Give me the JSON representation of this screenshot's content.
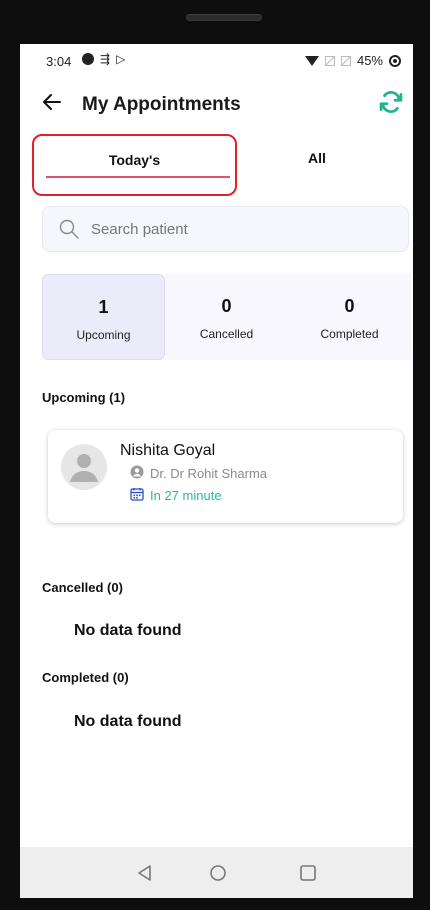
{
  "status_bar": {
    "time": "3:04",
    "battery": "45%"
  },
  "app_bar": {
    "title": "My Appointments",
    "back_icon": "arrow-left-icon",
    "refresh_icon": "refresh-icon",
    "accent_color": "#1fb58f"
  },
  "tabs": [
    {
      "label": "Today's",
      "selected": true
    },
    {
      "label": "All",
      "selected": false
    }
  ],
  "search": {
    "placeholder": "Search patient",
    "value": ""
  },
  "counts": [
    {
      "count": "1",
      "label": "Upcoming",
      "active": true
    },
    {
      "count": "0",
      "label": "Cancelled",
      "active": false
    },
    {
      "count": "0",
      "label": "Completed",
      "active": false
    }
  ],
  "sections": {
    "upcoming_title": "Upcoming (1)",
    "cancelled_title": "Cancelled (0)",
    "cancelled_empty": "No data found",
    "completed_title": "Completed (0)",
    "completed_empty": "No data found"
  },
  "appointments": [
    {
      "patient_name": "Nishita Goyal",
      "doctor": "Dr. Dr Rohit Sharma",
      "time_text": "In 27 minute",
      "time_color": "#2bb89c"
    }
  ],
  "nav_bar": {
    "back": "triangle-back-icon",
    "home": "circle-home-icon",
    "recents": "square-recents-icon"
  }
}
